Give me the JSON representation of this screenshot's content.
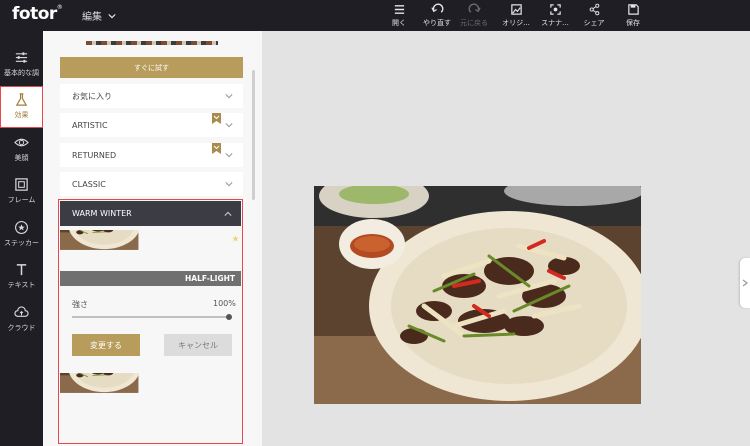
{
  "app": {
    "logo": "fotor",
    "logo_mark": "®",
    "edit_menu": "編集"
  },
  "toolbar": [
    {
      "label": "開く",
      "icon": "menu-icon",
      "enabled": true
    },
    {
      "label": "やり直す",
      "icon": "undo-icon",
      "enabled": true
    },
    {
      "label": "元に戻る",
      "icon": "redo-icon",
      "enabled": false
    },
    {
      "label": "オリジ...",
      "icon": "compare-icon",
      "enabled": true
    },
    {
      "label": "スナナ...",
      "icon": "snapshot-icon",
      "enabled": true
    },
    {
      "label": "シェア",
      "icon": "share-icon",
      "enabled": true
    },
    {
      "label": "保存",
      "icon": "save-icon",
      "enabled": true
    }
  ],
  "sidebar": [
    {
      "label": "基本的な調",
      "icon": "adjust-sliders-icon",
      "active": false
    },
    {
      "label": "効果",
      "icon": "flask-icon",
      "active": true
    },
    {
      "label": "美顔",
      "icon": "eye-icon",
      "active": false
    },
    {
      "label": "フレーム",
      "icon": "frame-icon",
      "active": false
    },
    {
      "label": "ステッカー",
      "icon": "sticker-icon",
      "active": false
    },
    {
      "label": "テキスト",
      "icon": "text-icon",
      "active": false
    },
    {
      "label": "クラウド",
      "icon": "cloud-icon",
      "active": false
    }
  ],
  "panel": {
    "try_button": "すぐに試す",
    "categories": [
      {
        "label": "お気に入り",
        "bookmarked": false
      },
      {
        "label": "ARTISTIC",
        "bookmarked": true
      },
      {
        "label": "RETURNED",
        "bookmarked": true
      },
      {
        "label": "CLASSIC",
        "bookmarked": false
      }
    ],
    "expanded": {
      "title": "WARM WINTER",
      "effect_name": "HALF-LIGHT",
      "strength_label": "強さ",
      "strength_value": "100%",
      "strength_level": 1.0,
      "apply_button": "変更する",
      "cancel_button": "キャンセル"
    }
  },
  "colors": {
    "accent_gold": "#b79c5b",
    "dark_bar": "#1e1e24",
    "highlight_red": "#e5494f",
    "canvas_bg": "#e3e3e3"
  }
}
